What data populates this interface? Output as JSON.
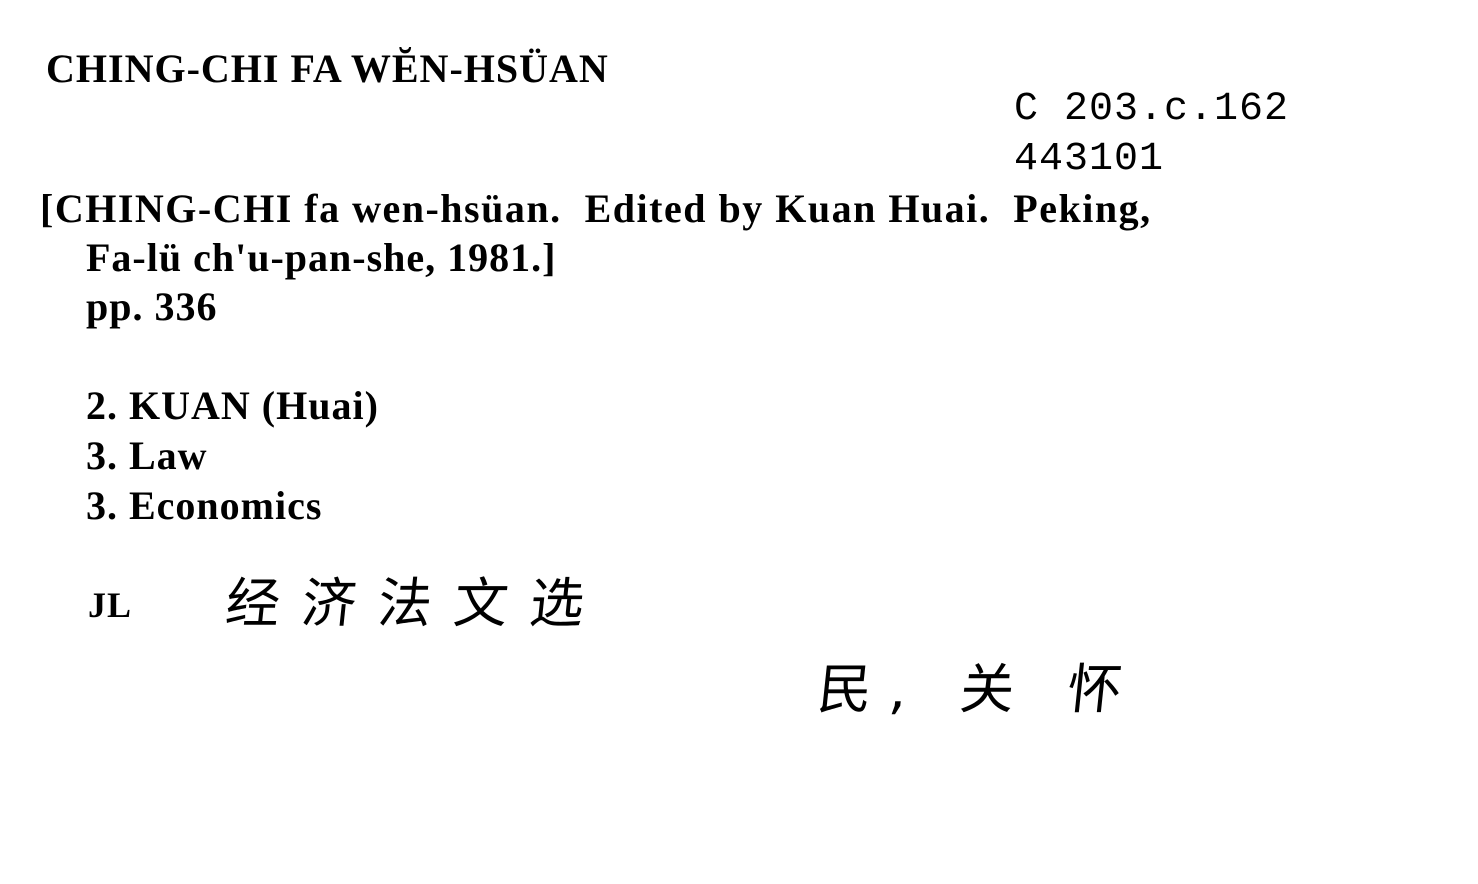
{
  "card": {
    "heading": "CHING-CHI FA WĔN-HSÜAN",
    "shelfmark": "C 203.c.162",
    "accession_number": "443101",
    "imprint_line_1": "[CHING-CHI fa wen-hsüan.  Edited by Kuan Huai.  Peking,",
    "imprint_line_2": "Fa-lü ch'u-pan-she, 1981.]",
    "pagination": "pp. 336",
    "added_entries": [
      "2. KUAN (Huai)",
      "3. Law",
      "3. Economics"
    ],
    "cataloguer_initials": "JL",
    "chinese_title": "经济法文选",
    "chinese_author": "民, 关 怀"
  }
}
